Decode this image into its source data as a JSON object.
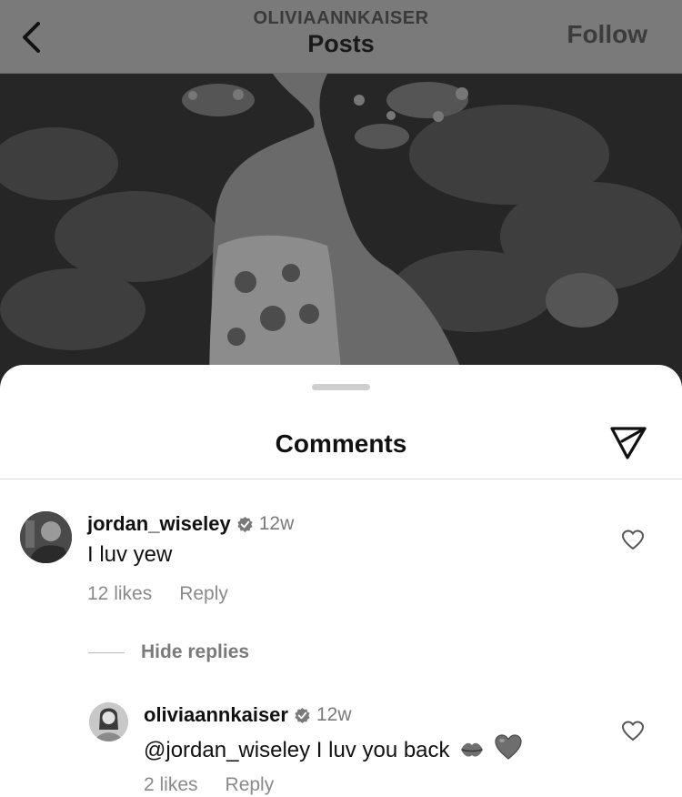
{
  "header": {
    "username": "OLIVIAANNKAISER",
    "title": "Posts",
    "follow_label": "Follow"
  },
  "comments_sheet": {
    "title": "Comments",
    "comments": [
      {
        "username": "jordan_wiseley",
        "verified": true,
        "time": "12w",
        "text": "I luv yew",
        "likes": "12 likes",
        "reply_label": "Reply",
        "hide_replies_label": "Hide replies",
        "replies": [
          {
            "username": "oliviaannkaiser",
            "verified": true,
            "time": "12w",
            "text": "@jordan_wiseley I luv you back",
            "emojis": [
              "kiss-mark-icon",
              "heart-icon"
            ],
            "likes": "2 likes",
            "reply_label": "Reply"
          }
        ]
      }
    ]
  },
  "colors": {
    "sheet_bg": "#ffffff",
    "muted_text": "#8a8a8a",
    "header_tint": "#7a7a7a"
  }
}
